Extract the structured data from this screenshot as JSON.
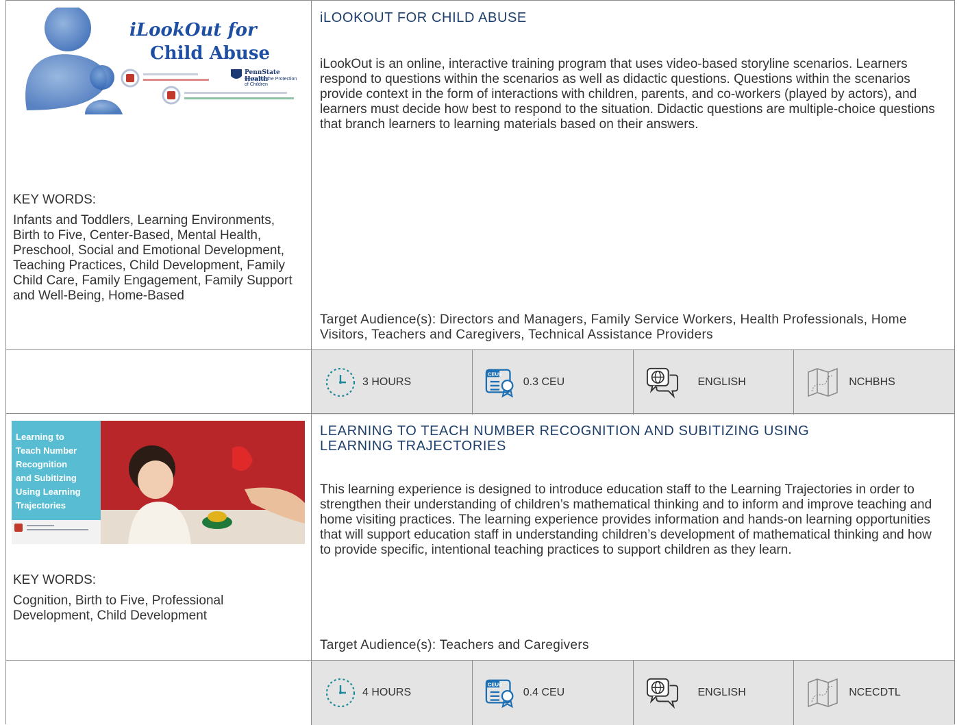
{
  "colors": {
    "accent_teal": "#1d8a99",
    "title_navy": "#1f3f6b",
    "meta_bg": "#e4e4e4",
    "border": "#8c8c8c"
  },
  "keywords_label": "KEY WORDS:",
  "courses": [
    {
      "thumb": {
        "title_line1": "iLookOut for",
        "title_line2": "Child Abuse",
        "logo_text": "PennState Health",
        "logo_sub": "Center for the Protection of Children"
      },
      "title": "iLOOKOUT FOR CHILD ABUSE",
      "description": "iLookOut is an online, interactive training program that uses video-based storyline scenarios. Learners respond to questions within the scenarios as well as didactic questions. Questions within the scenarios provide context in the form of interactions with children, parents, and co-workers (played by actors), and learners must decide how best to respond to the situation. Didactic questions are multiple-choice questions that branch learners to learning materials based on their answers.",
      "keywords": "Infants and Toddlers, Learning Environments, Birth to Five, Center-Based, Mental Health, Preschool, Social and Emotional Development, Teaching Practices, Child Development, Family Child Care, Family Engagement, Family Support and Well-Being, Home-Based",
      "audience": "Target Audience(s): Directors and Managers, Family Service Workers, Health Professionals, Home Visitors, Teachers and Caregivers, Technical Assistance Providers",
      "meta": {
        "duration": "3 HOURS",
        "ceu": "0.3 CEU",
        "language": "ENGLISH",
        "provider": "NCHBHS",
        "ceu_icon_text": "CEUs"
      },
      "icons": {
        "duration": "clock-icon",
        "ceu": "ceu-certificate-icon",
        "language": "language-globe-icon",
        "provider": "map-icon"
      }
    },
    {
      "thumb": {
        "overlay_lines": [
          "Learning to",
          "Teach Number",
          "Recognition",
          "and Subitizing",
          "Using Learning",
          "Trajectories"
        ]
      },
      "title": "LEARNING TO TEACH NUMBER RECOGNITION AND SUBITIZING USING LEARNING TRAJECTORIES",
      "description": "This learning experience is designed to introduce education staff to the Learning Trajectories in order to strengthen their understanding of children’s mathematical thinking and to inform and improve teaching and home visiting practices. The learning experience provides information and hands-on learning opportunities that will support education staff in understanding children’s development of mathematical thinking and how to provide specific, intentional teaching practices to support children as they learn.",
      "keywords": "Cognition, Birth to Five, Professional Development, Child Development",
      "audience": "Target Audience(s): Teachers and Caregivers",
      "meta": {
        "duration": "4 HOURS",
        "ceu": "0.4 CEU",
        "language": "ENGLISH",
        "provider": "NCECDTL",
        "ceu_icon_text": "CEUs"
      },
      "icons": {
        "duration": "clock-icon",
        "ceu": "ceu-certificate-icon",
        "language": "language-globe-icon",
        "provider": "map-icon"
      }
    }
  ]
}
